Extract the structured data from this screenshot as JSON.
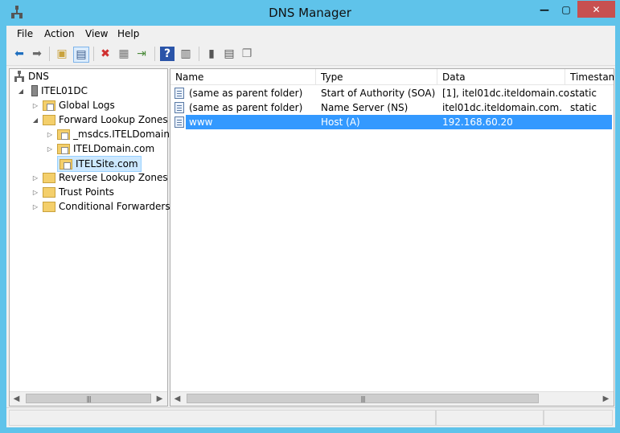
{
  "window": {
    "title": "DNS Manager",
    "controls": {
      "minimize": "—",
      "maximize": "▢",
      "close": "✕"
    }
  },
  "menu": [
    "File",
    "Action",
    "View",
    "Help"
  ],
  "tree": {
    "root": "DNS",
    "server": "ITEL01DC",
    "items": [
      {
        "label": "Global Logs"
      },
      {
        "label": "Forward Lookup Zones"
      },
      {
        "label": "_msdcs.ITELDomain.c"
      },
      {
        "label": "ITELDomain.com"
      },
      {
        "label": "ITELSite.com"
      },
      {
        "label": "Reverse Lookup Zones"
      },
      {
        "label": "Trust Points"
      },
      {
        "label": "Conditional Forwarders"
      }
    ]
  },
  "list": {
    "columns": [
      "Name",
      "Type",
      "Data",
      "Timestam"
    ],
    "rows": [
      {
        "name": "(same as parent folder)",
        "type": "Start of Authority (SOA)",
        "data": "[1], itel01dc.iteldomain.co...",
        "timestamp": "static"
      },
      {
        "name": "(same as parent folder)",
        "type": "Name Server (NS)",
        "data": "itel01dc.iteldomain.com.",
        "timestamp": "static"
      },
      {
        "name": "www",
        "type": "Host (A)",
        "data": "192.168.60.20",
        "timestamp": ""
      }
    ]
  },
  "colors": {
    "title_bar": "#5fc3ea",
    "selection": "#3399ff",
    "close_button": "#c75050"
  }
}
